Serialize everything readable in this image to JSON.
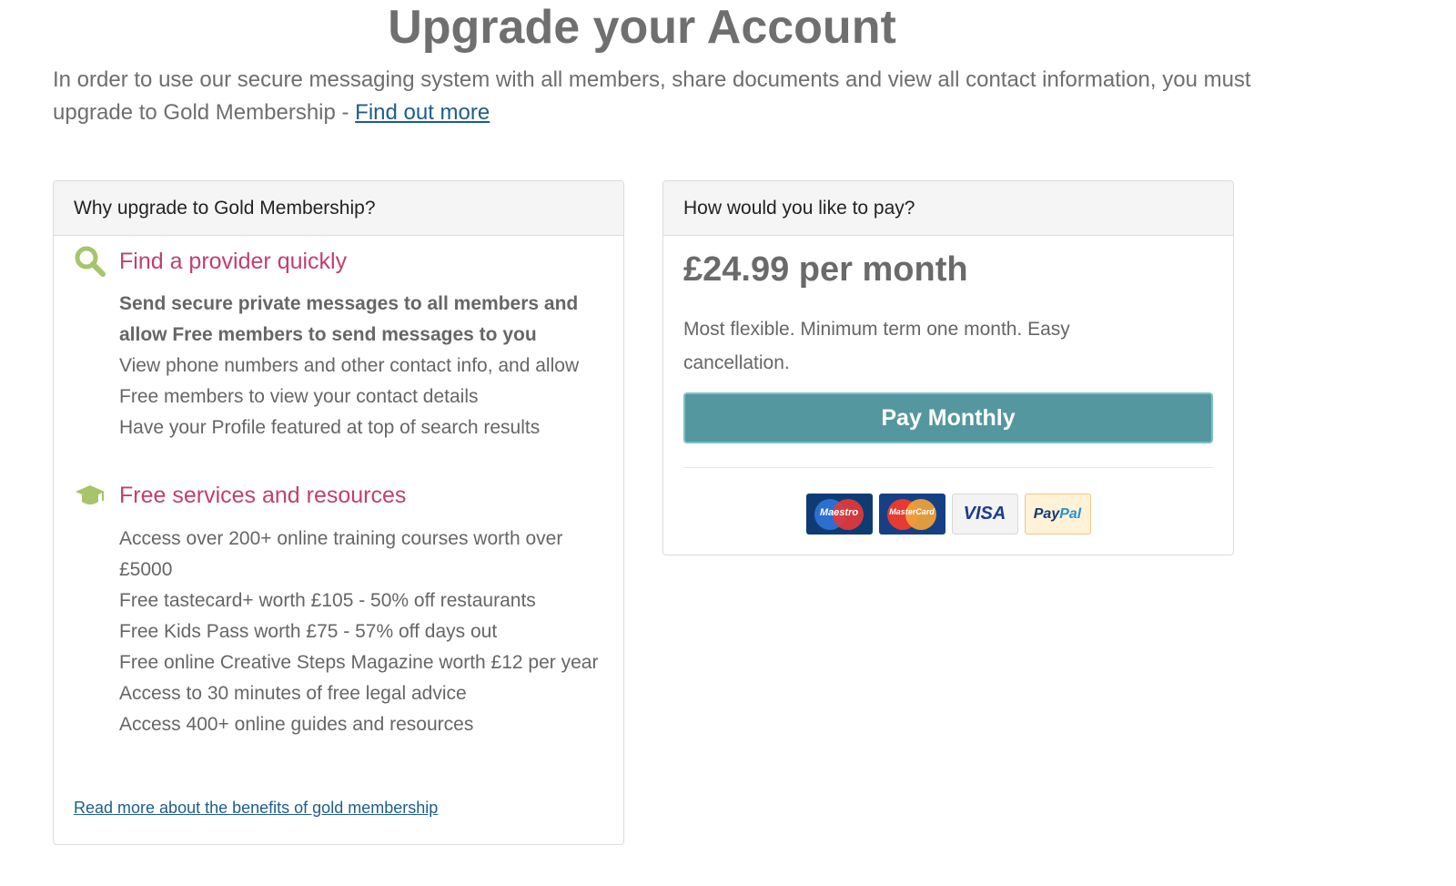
{
  "page": {
    "title": "Upgrade your Account",
    "intro_text": "In order to use our secure messaging system with all members, share documents and view all contact information, you must upgrade to Gold Membership - ",
    "intro_link": "Find out more"
  },
  "why_panel": {
    "heading": "Why upgrade to Gold Membership?",
    "sections": [
      {
        "icon": "search-icon",
        "title": "Find a provider quickly",
        "items": [
          "Send secure private messages to all members and allow Free members to send messages to you",
          "View phone numbers and other contact info, and allow Free members to view your contact details",
          "Have your Profile featured at top of search results"
        ]
      },
      {
        "icon": "graduation-cap-icon",
        "title": "Free services and resources",
        "items": [
          "Access over 200+ online training courses worth over £5000",
          "Free tastecard+ worth £105 - 50% off restaurants",
          "Free Kids Pass worth £75 - 57% off days out",
          "Free online Creative Steps Magazine worth £12 per year",
          "Access to 30 minutes of free legal advice",
          "Access 400+ online guides and resources"
        ]
      }
    ],
    "more_link": "Read more about the benefits of gold membership"
  },
  "pay_panel": {
    "heading": "How would you like to pay?",
    "price": "£24.99 per month",
    "description": "Most flexible. Minimum term one month. Easy cancellation.",
    "button_label": "Pay Monthly",
    "cards": {
      "maestro": "Maestro",
      "mastercard": "MasterCard",
      "visa": "VISA",
      "paypal_a": "Pay",
      "paypal_b": "Pal"
    }
  },
  "colors": {
    "accent_pink": "#c23f6e",
    "icon_green": "#a6c46a",
    "button_teal": "#55979e",
    "link_blue": "#1f5d8c"
  }
}
